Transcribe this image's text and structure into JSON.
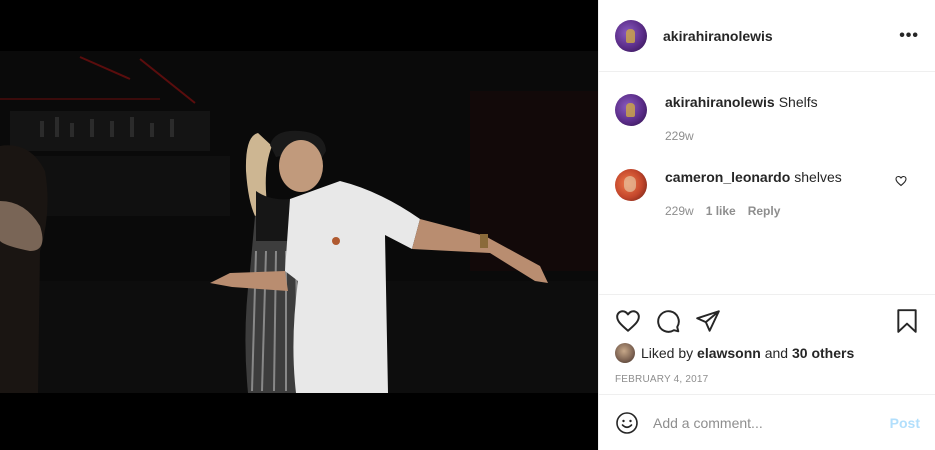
{
  "post": {
    "username": "akirahiranolewis",
    "more_label": "•••"
  },
  "caption": {
    "username": "akirahiranolewis",
    "text": "Shelfs",
    "age": "229w"
  },
  "comments": [
    {
      "username": "cameron_leonardo",
      "text": "shelves",
      "age": "229w",
      "likes": "1 like",
      "reply": "Reply"
    }
  ],
  "likes": {
    "prefix": "Liked by",
    "user": "elawsonn",
    "joiner": "and",
    "others": "30 others"
  },
  "date": "FEBRUARY 4, 2017",
  "add_comment": {
    "placeholder": "Add a comment...",
    "post_label": "Post"
  },
  "icons": {
    "like": "heart-icon",
    "comment": "comment-bubble-icon",
    "share": "paper-plane-icon",
    "save": "bookmark-icon",
    "emoji": "smiley-icon"
  },
  "colors": {
    "post_disabled": "#b2dffc",
    "meta_gray": "#8e8e8e",
    "text": "#262626"
  }
}
